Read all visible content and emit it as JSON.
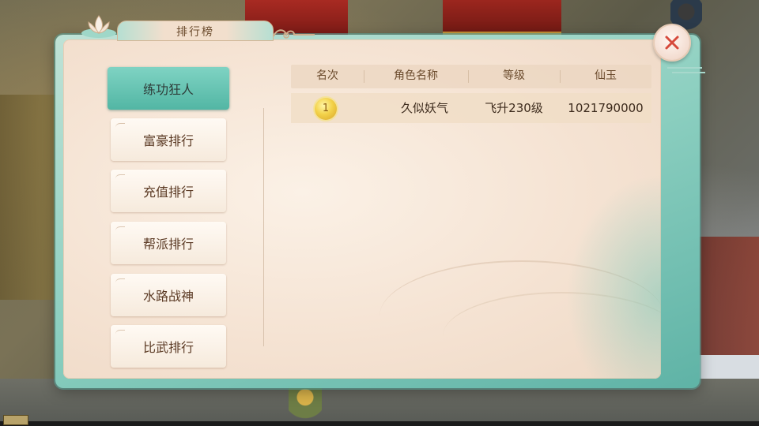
{
  "panel": {
    "title": "排行榜"
  },
  "tabs": [
    {
      "label": "练功狂人",
      "active": true
    },
    {
      "label": "富豪排行",
      "active": false
    },
    {
      "label": "充值排行",
      "active": false
    },
    {
      "label": "帮派排行",
      "active": false
    },
    {
      "label": "水路战神",
      "active": false
    },
    {
      "label": "比武排行",
      "active": false
    }
  ],
  "table": {
    "headers": [
      "名次",
      "角色名称",
      "等级",
      "仙玉"
    ],
    "rows": [
      {
        "rank": "1",
        "name": "久似妖气",
        "level": "飞升230级",
        "jade": "1021790000"
      }
    ]
  },
  "icons": {
    "close": "close-icon",
    "medal": "gold-medal-icon",
    "lotus": "lotus-icon",
    "cloud": "cloud-ornament-icon"
  },
  "colors": {
    "active_tab": "#52b6a4",
    "close_x": "#d64a3c",
    "medal_gold": "#f3d24a"
  }
}
